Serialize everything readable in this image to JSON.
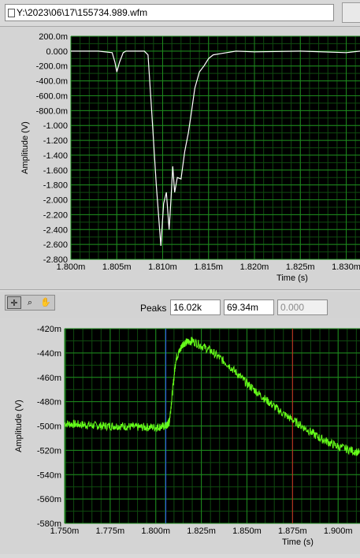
{
  "window": {
    "file_path": "Y:\\2023\\06\\17\\155734.989.wfm"
  },
  "peaks": {
    "label": "Peaks",
    "values": [
      "16.02k",
      "69.34m",
      "0.000"
    ]
  },
  "colors": {
    "plot_bg": "#000000",
    "grid": "#1e8a1e",
    "trace_top": "#ffffff",
    "trace_bottom": "#66ff1a",
    "cursor_blue": "#3366ff",
    "cursor_red": "#cc2222"
  },
  "tools": [
    "crosshair-cursor-icon",
    "zoom-icon",
    "hand-pan-icon"
  ],
  "chart_data": [
    {
      "type": "line",
      "title": "",
      "xlabel": "Time (s)",
      "ylabel": "Amplitude (V)",
      "xlim": [
        1.8,
        1.8315
      ],
      "ylim": [
        -2.8,
        0.2
      ],
      "x_ticks": [
        "1.800m",
        "1.805m",
        "1.810m",
        "1.815m",
        "1.820m",
        "1.825m",
        "1.830m"
      ],
      "y_ticks": [
        "200.0m",
        "0.000",
        "-200.0m",
        "-400.0m",
        "-600.0m",
        "-800.0m",
        "-1.000",
        "-1.200",
        "-1.400",
        "-1.600",
        "-1.800",
        "-2.000",
        "-2.200",
        "-2.400",
        "-2.600",
        "-2.800"
      ],
      "series": [
        {
          "x": [
            1.8,
            1.803,
            1.8045,
            1.8048,
            1.805,
            1.8053,
            1.8057,
            1.806,
            1.808,
            1.8084,
            1.8088,
            1.8093,
            1.8098,
            1.8101,
            1.8104,
            1.8107,
            1.8109,
            1.8111,
            1.8113,
            1.8116,
            1.812,
            1.8124,
            1.8128,
            1.8131,
            1.8135,
            1.814,
            1.8145,
            1.815,
            1.8155,
            1.8165,
            1.818,
            1.82,
            1.825,
            1.83,
            1.8315
          ],
          "y": [
            0.0,
            0.0,
            -0.02,
            -0.15,
            -0.28,
            -0.15,
            -0.02,
            0.0,
            0.0,
            -0.05,
            -0.8,
            -1.8,
            -2.62,
            -2.05,
            -1.9,
            -2.4,
            -2.0,
            -1.55,
            -1.9,
            -1.7,
            -1.72,
            -1.35,
            -1.1,
            -0.85,
            -0.5,
            -0.28,
            -0.2,
            -0.1,
            -0.05,
            -0.03,
            0.0,
            -0.01,
            0.0,
            -0.02,
            0.0
          ]
        }
      ]
    },
    {
      "type": "line",
      "title": "",
      "xlabel": "Time (s)",
      "ylabel": "Amplitude (V)",
      "xlim": [
        1.75,
        1.912
      ],
      "ylim": [
        -0.58,
        -0.42
      ],
      "x_ticks": [
        "1.750m",
        "1.775m",
        "1.800m",
        "1.825m",
        "1.850m",
        "1.875m",
        "1.900m"
      ],
      "y_ticks": [
        "-420m",
        "-440m",
        "-460m",
        "-480m",
        "-500m",
        "-520m",
        "-540m",
        "-560m",
        "-580m"
      ],
      "cursors": [
        1.7505,
        1.8055,
        1.875
      ],
      "series": [
        {
          "x": [
            1.75,
            1.76,
            1.77,
            1.78,
            1.79,
            1.8,
            1.806,
            1.8075,
            1.811,
            1.815,
            1.82,
            1.83,
            1.84,
            1.85,
            1.86,
            1.87,
            1.88,
            1.89,
            1.9,
            1.912
          ],
          "y": [
            -0.498,
            -0.499,
            -0.5,
            -0.5,
            -0.501,
            -0.501,
            -0.5,
            -0.496,
            -0.445,
            -0.432,
            -0.43,
            -0.438,
            -0.45,
            -0.465,
            -0.478,
            -0.49,
            -0.5,
            -0.51,
            -0.517,
            -0.522
          ]
        }
      ]
    }
  ]
}
